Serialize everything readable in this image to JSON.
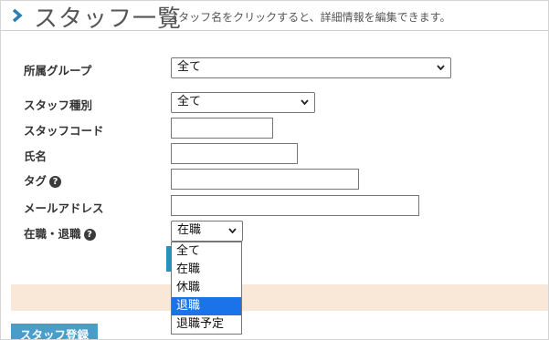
{
  "header": {
    "title": "スタッフ一覧",
    "subtitle": "- スタッフ名をクリックすると、詳細情報を編集できます。"
  },
  "form": {
    "group_label": "所属グループ",
    "group_value": "全て",
    "type_label": "スタッフ種別",
    "type_value": "全て",
    "code_label": "スタッフコード",
    "code_value": "",
    "name_label": "氏名",
    "name_value": "",
    "tag_label": "タグ",
    "email_label": "メールアドレス",
    "email_value": "",
    "status_label": "在職・退職",
    "status_value": "在職",
    "help_glyph": "?"
  },
  "status_options": [
    "全て",
    "在職",
    "休職",
    "退職",
    "退職予定"
  ],
  "status_highlighted": "退職",
  "buttons": {
    "register": "スタッフ登録"
  },
  "colors": {
    "accent": "#1a73e8",
    "band": "#f9e8d8",
    "button": "#4a9cc9",
    "chevron": "#2b7fb3"
  }
}
